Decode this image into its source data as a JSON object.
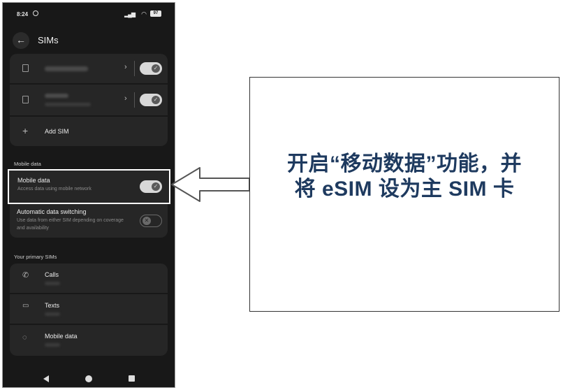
{
  "status_bar": {
    "time": "8:24",
    "battery": "97"
  },
  "header": {
    "title": "SIMs"
  },
  "sims": {
    "add_sim_label": "Add SIM"
  },
  "mobile_data_section": {
    "heading": "Mobile data",
    "mobile_data": {
      "title": "Mobile data",
      "subtitle": "Access data using mobile network",
      "enabled": true
    },
    "auto_switch": {
      "title": "Automatic data switching",
      "subtitle": "Use data from either SIM depending on coverage and availability",
      "enabled": false
    }
  },
  "primary_sims": {
    "heading": "Your primary SIMs",
    "items": [
      {
        "label": "Calls",
        "icon": "phone-icon"
      },
      {
        "label": "Texts",
        "icon": "message-icon"
      },
      {
        "label": "Mobile data",
        "icon": "data-icon"
      }
    ]
  },
  "callout": {
    "line1": "开启“移动数据”功能，并",
    "line2": "将 eSIM 设为主 SIM 卡"
  },
  "colors": {
    "highlight_border": "#ffffff",
    "callout_text": "#1e3a5f",
    "phone_bg": "#181818",
    "card_bg": "#262626"
  }
}
